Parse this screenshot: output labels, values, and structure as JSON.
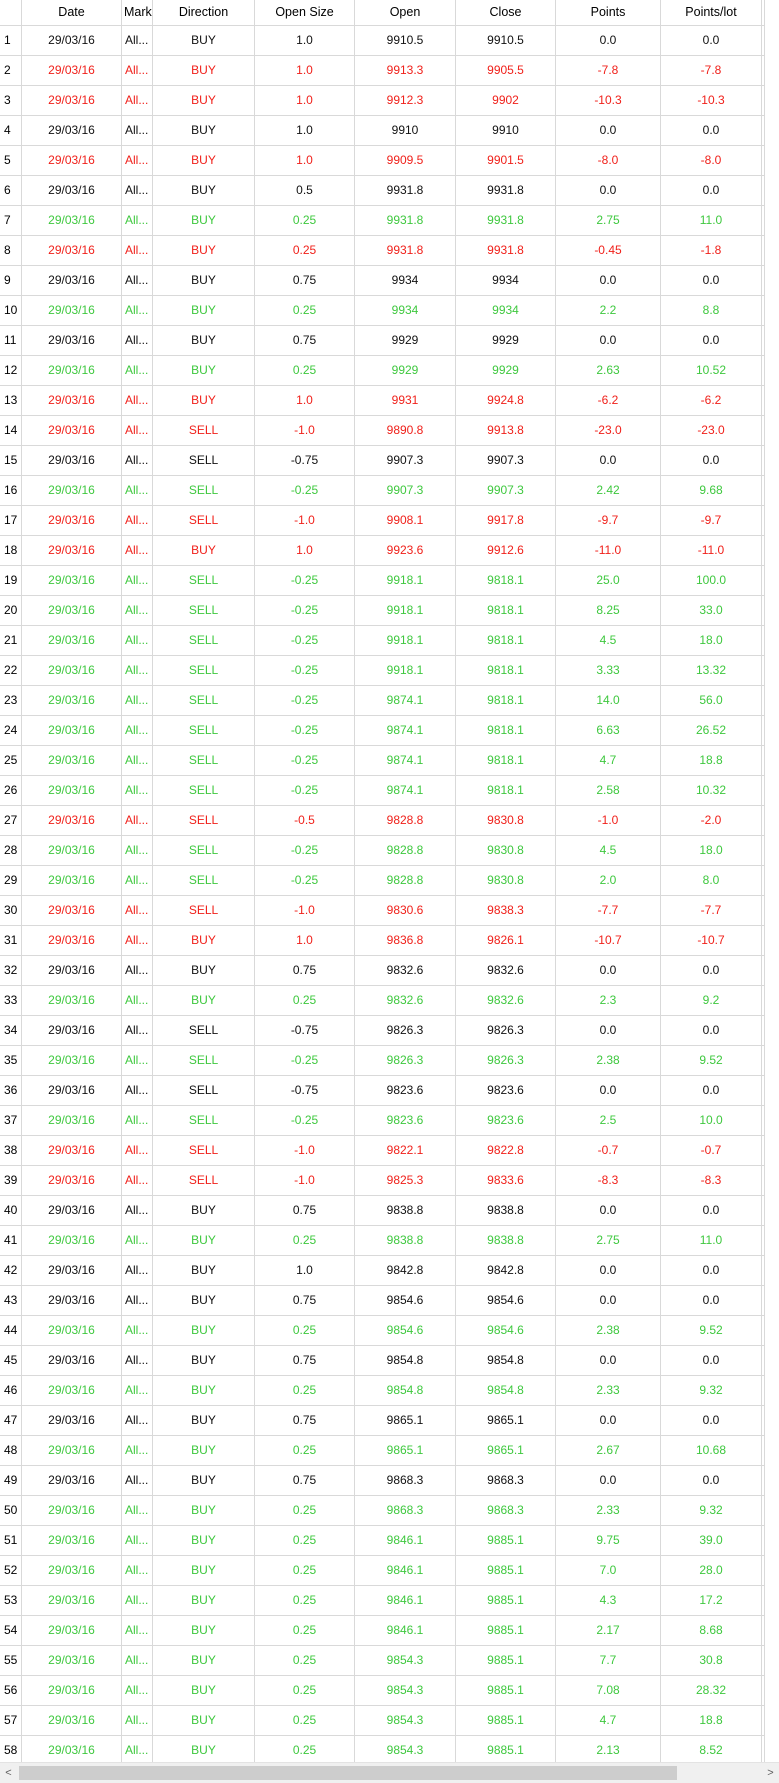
{
  "columns": [
    "Date",
    "Market",
    "Direction",
    "Open Size",
    "Open",
    "Close",
    "Points",
    "Points/lot"
  ],
  "colors": {
    "black": "#111111",
    "red": "#f0201a",
    "green": "#3ec83e",
    "grid": "#d9d9d9"
  },
  "scrollbar": {
    "left_arrow": "<",
    "right_arrow": ">"
  },
  "rows": [
    {
      "n": "1",
      "date": "29/03/16",
      "market": "All...",
      "dir": "BUY",
      "size": "1.0",
      "open": "9910.5",
      "close": "9910.5",
      "points": "0.0",
      "ppl": "0.0",
      "color": "black"
    },
    {
      "n": "2",
      "date": "29/03/16",
      "market": "All...",
      "dir": "BUY",
      "size": "1.0",
      "open": "9913.3",
      "close": "9905.5",
      "points": "-7.8",
      "ppl": "-7.8",
      "color": "red"
    },
    {
      "n": "3",
      "date": "29/03/16",
      "market": "All...",
      "dir": "BUY",
      "size": "1.0",
      "open": "9912.3",
      "close": "9902",
      "points": "-10.3",
      "ppl": "-10.3",
      "color": "red"
    },
    {
      "n": "4",
      "date": "29/03/16",
      "market": "All...",
      "dir": "BUY",
      "size": "1.0",
      "open": "9910",
      "close": "9910",
      "points": "0.0",
      "ppl": "0.0",
      "color": "black"
    },
    {
      "n": "5",
      "date": "29/03/16",
      "market": "All...",
      "dir": "BUY",
      "size": "1.0",
      "open": "9909.5",
      "close": "9901.5",
      "points": "-8.0",
      "ppl": "-8.0",
      "color": "red"
    },
    {
      "n": "6",
      "date": "29/03/16",
      "market": "All...",
      "dir": "BUY",
      "size": "0.5",
      "open": "9931.8",
      "close": "9931.8",
      "points": "0.0",
      "ppl": "0.0",
      "color": "black"
    },
    {
      "n": "7",
      "date": "29/03/16",
      "market": "All...",
      "dir": "BUY",
      "size": "0.25",
      "open": "9931.8",
      "close": "9931.8",
      "points": "2.75",
      "ppl": "11.0",
      "color": "green"
    },
    {
      "n": "8",
      "date": "29/03/16",
      "market": "All...",
      "dir": "BUY",
      "size": "0.25",
      "open": "9931.8",
      "close": "9931.8",
      "points": "-0.45",
      "ppl": "-1.8",
      "color": "red"
    },
    {
      "n": "9",
      "date": "29/03/16",
      "market": "All...",
      "dir": "BUY",
      "size": "0.75",
      "open": "9934",
      "close": "9934",
      "points": "0.0",
      "ppl": "0.0",
      "color": "black"
    },
    {
      "n": "10",
      "date": "29/03/16",
      "market": "All...",
      "dir": "BUY",
      "size": "0.25",
      "open": "9934",
      "close": "9934",
      "points": "2.2",
      "ppl": "8.8",
      "color": "green"
    },
    {
      "n": "11",
      "date": "29/03/16",
      "market": "All...",
      "dir": "BUY",
      "size": "0.75",
      "open": "9929",
      "close": "9929",
      "points": "0.0",
      "ppl": "0.0",
      "color": "black"
    },
    {
      "n": "12",
      "date": "29/03/16",
      "market": "All...",
      "dir": "BUY",
      "size": "0.25",
      "open": "9929",
      "close": "9929",
      "points": "2.63",
      "ppl": "10.52",
      "color": "green"
    },
    {
      "n": "13",
      "date": "29/03/16",
      "market": "All...",
      "dir": "BUY",
      "size": "1.0",
      "open": "9931",
      "close": "9924.8",
      "points": "-6.2",
      "ppl": "-6.2",
      "color": "red"
    },
    {
      "n": "14",
      "date": "29/03/16",
      "market": "All...",
      "dir": "SELL",
      "size": "-1.0",
      "open": "9890.8",
      "close": "9913.8",
      "points": "-23.0",
      "ppl": "-23.0",
      "color": "red"
    },
    {
      "n": "15",
      "date": "29/03/16",
      "market": "All...",
      "dir": "SELL",
      "size": "-0.75",
      "open": "9907.3",
      "close": "9907.3",
      "points": "0.0",
      "ppl": "0.0",
      "color": "black"
    },
    {
      "n": "16",
      "date": "29/03/16",
      "market": "All...",
      "dir": "SELL",
      "size": "-0.25",
      "open": "9907.3",
      "close": "9907.3",
      "points": "2.42",
      "ppl": "9.68",
      "color": "green"
    },
    {
      "n": "17",
      "date": "29/03/16",
      "market": "All...",
      "dir": "SELL",
      "size": "-1.0",
      "open": "9908.1",
      "close": "9917.8",
      "points": "-9.7",
      "ppl": "-9.7",
      "color": "red"
    },
    {
      "n": "18",
      "date": "29/03/16",
      "market": "All...",
      "dir": "BUY",
      "size": "1.0",
      "open": "9923.6",
      "close": "9912.6",
      "points": "-11.0",
      "ppl": "-11.0",
      "color": "red"
    },
    {
      "n": "19",
      "date": "29/03/16",
      "market": "All...",
      "dir": "SELL",
      "size": "-0.25",
      "open": "9918.1",
      "close": "9818.1",
      "points": "25.0",
      "ppl": "100.0",
      "color": "green"
    },
    {
      "n": "20",
      "date": "29/03/16",
      "market": "All...",
      "dir": "SELL",
      "size": "-0.25",
      "open": "9918.1",
      "close": "9818.1",
      "points": "8.25",
      "ppl": "33.0",
      "color": "green"
    },
    {
      "n": "21",
      "date": "29/03/16",
      "market": "All...",
      "dir": "SELL",
      "size": "-0.25",
      "open": "9918.1",
      "close": "9818.1",
      "points": "4.5",
      "ppl": "18.0",
      "color": "green"
    },
    {
      "n": "22",
      "date": "29/03/16",
      "market": "All...",
      "dir": "SELL",
      "size": "-0.25",
      "open": "9918.1",
      "close": "9818.1",
      "points": "3.33",
      "ppl": "13.32",
      "color": "green"
    },
    {
      "n": "23",
      "date": "29/03/16",
      "market": "All...",
      "dir": "SELL",
      "size": "-0.25",
      "open": "9874.1",
      "close": "9818.1",
      "points": "14.0",
      "ppl": "56.0",
      "color": "green"
    },
    {
      "n": "24",
      "date": "29/03/16",
      "market": "All...",
      "dir": "SELL",
      "size": "-0.25",
      "open": "9874.1",
      "close": "9818.1",
      "points": "6.63",
      "ppl": "26.52",
      "color": "green"
    },
    {
      "n": "25",
      "date": "29/03/16",
      "market": "All...",
      "dir": "SELL",
      "size": "-0.25",
      "open": "9874.1",
      "close": "9818.1",
      "points": "4.7",
      "ppl": "18.8",
      "color": "green"
    },
    {
      "n": "26",
      "date": "29/03/16",
      "market": "All...",
      "dir": "SELL",
      "size": "-0.25",
      "open": "9874.1",
      "close": "9818.1",
      "points": "2.58",
      "ppl": "10.32",
      "color": "green"
    },
    {
      "n": "27",
      "date": "29/03/16",
      "market": "All...",
      "dir": "SELL",
      "size": "-0.5",
      "open": "9828.8",
      "close": "9830.8",
      "points": "-1.0",
      "ppl": "-2.0",
      "color": "red"
    },
    {
      "n": "28",
      "date": "29/03/16",
      "market": "All...",
      "dir": "SELL",
      "size": "-0.25",
      "open": "9828.8",
      "close": "9830.8",
      "points": "4.5",
      "ppl": "18.0",
      "color": "green"
    },
    {
      "n": "29",
      "date": "29/03/16",
      "market": "All...",
      "dir": "SELL",
      "size": "-0.25",
      "open": "9828.8",
      "close": "9830.8",
      "points": "2.0",
      "ppl": "8.0",
      "color": "green"
    },
    {
      "n": "30",
      "date": "29/03/16",
      "market": "All...",
      "dir": "SELL",
      "size": "-1.0",
      "open": "9830.6",
      "close": "9838.3",
      "points": "-7.7",
      "ppl": "-7.7",
      "color": "red"
    },
    {
      "n": "31",
      "date": "29/03/16",
      "market": "All...",
      "dir": "BUY",
      "size": "1.0",
      "open": "9836.8",
      "close": "9826.1",
      "points": "-10.7",
      "ppl": "-10.7",
      "color": "red"
    },
    {
      "n": "32",
      "date": "29/03/16",
      "market": "All...",
      "dir": "BUY",
      "size": "0.75",
      "open": "9832.6",
      "close": "9832.6",
      "points": "0.0",
      "ppl": "0.0",
      "color": "black"
    },
    {
      "n": "33",
      "date": "29/03/16",
      "market": "All...",
      "dir": "BUY",
      "size": "0.25",
      "open": "9832.6",
      "close": "9832.6",
      "points": "2.3",
      "ppl": "9.2",
      "color": "green"
    },
    {
      "n": "34",
      "date": "29/03/16",
      "market": "All...",
      "dir": "SELL",
      "size": "-0.75",
      "open": "9826.3",
      "close": "9826.3",
      "points": "0.0",
      "ppl": "0.0",
      "color": "black"
    },
    {
      "n": "35",
      "date": "29/03/16",
      "market": "All...",
      "dir": "SELL",
      "size": "-0.25",
      "open": "9826.3",
      "close": "9826.3",
      "points": "2.38",
      "ppl": "9.52",
      "color": "green"
    },
    {
      "n": "36",
      "date": "29/03/16",
      "market": "All...",
      "dir": "SELL",
      "size": "-0.75",
      "open": "9823.6",
      "close": "9823.6",
      "points": "0.0",
      "ppl": "0.0",
      "color": "black"
    },
    {
      "n": "37",
      "date": "29/03/16",
      "market": "All...",
      "dir": "SELL",
      "size": "-0.25",
      "open": "9823.6",
      "close": "9823.6",
      "points": "2.5",
      "ppl": "10.0",
      "color": "green"
    },
    {
      "n": "38",
      "date": "29/03/16",
      "market": "All...",
      "dir": "SELL",
      "size": "-1.0",
      "open": "9822.1",
      "close": "9822.8",
      "points": "-0.7",
      "ppl": "-0.7",
      "color": "red"
    },
    {
      "n": "39",
      "date": "29/03/16",
      "market": "All...",
      "dir": "SELL",
      "size": "-1.0",
      "open": "9825.3",
      "close": "9833.6",
      "points": "-8.3",
      "ppl": "-8.3",
      "color": "red"
    },
    {
      "n": "40",
      "date": "29/03/16",
      "market": "All...",
      "dir": "BUY",
      "size": "0.75",
      "open": "9838.8",
      "close": "9838.8",
      "points": "0.0",
      "ppl": "0.0",
      "color": "black"
    },
    {
      "n": "41",
      "date": "29/03/16",
      "market": "All...",
      "dir": "BUY",
      "size": "0.25",
      "open": "9838.8",
      "close": "9838.8",
      "points": "2.75",
      "ppl": "11.0",
      "color": "green"
    },
    {
      "n": "42",
      "date": "29/03/16",
      "market": "All...",
      "dir": "BUY",
      "size": "1.0",
      "open": "9842.8",
      "close": "9842.8",
      "points": "0.0",
      "ppl": "0.0",
      "color": "black"
    },
    {
      "n": "43",
      "date": "29/03/16",
      "market": "All...",
      "dir": "BUY",
      "size": "0.75",
      "open": "9854.6",
      "close": "9854.6",
      "points": "0.0",
      "ppl": "0.0",
      "color": "black"
    },
    {
      "n": "44",
      "date": "29/03/16",
      "market": "All...",
      "dir": "BUY",
      "size": "0.25",
      "open": "9854.6",
      "close": "9854.6",
      "points": "2.38",
      "ppl": "9.52",
      "color": "green"
    },
    {
      "n": "45",
      "date": "29/03/16",
      "market": "All...",
      "dir": "BUY",
      "size": "0.75",
      "open": "9854.8",
      "close": "9854.8",
      "points": "0.0",
      "ppl": "0.0",
      "color": "black"
    },
    {
      "n": "46",
      "date": "29/03/16",
      "market": "All...",
      "dir": "BUY",
      "size": "0.25",
      "open": "9854.8",
      "close": "9854.8",
      "points": "2.33",
      "ppl": "9.32",
      "color": "green"
    },
    {
      "n": "47",
      "date": "29/03/16",
      "market": "All...",
      "dir": "BUY",
      "size": "0.75",
      "open": "9865.1",
      "close": "9865.1",
      "points": "0.0",
      "ppl": "0.0",
      "color": "black"
    },
    {
      "n": "48",
      "date": "29/03/16",
      "market": "All...",
      "dir": "BUY",
      "size": "0.25",
      "open": "9865.1",
      "close": "9865.1",
      "points": "2.67",
      "ppl": "10.68",
      "color": "green"
    },
    {
      "n": "49",
      "date": "29/03/16",
      "market": "All...",
      "dir": "BUY",
      "size": "0.75",
      "open": "9868.3",
      "close": "9868.3",
      "points": "0.0",
      "ppl": "0.0",
      "color": "black"
    },
    {
      "n": "50",
      "date": "29/03/16",
      "market": "All...",
      "dir": "BUY",
      "size": "0.25",
      "open": "9868.3",
      "close": "9868.3",
      "points": "2.33",
      "ppl": "9.32",
      "color": "green"
    },
    {
      "n": "51",
      "date": "29/03/16",
      "market": "All...",
      "dir": "BUY",
      "size": "0.25",
      "open": "9846.1",
      "close": "9885.1",
      "points": "9.75",
      "ppl": "39.0",
      "color": "green"
    },
    {
      "n": "52",
      "date": "29/03/16",
      "market": "All...",
      "dir": "BUY",
      "size": "0.25",
      "open": "9846.1",
      "close": "9885.1",
      "points": "7.0",
      "ppl": "28.0",
      "color": "green"
    },
    {
      "n": "53",
      "date": "29/03/16",
      "market": "All...",
      "dir": "BUY",
      "size": "0.25",
      "open": "9846.1",
      "close": "9885.1",
      "points": "4.3",
      "ppl": "17.2",
      "color": "green"
    },
    {
      "n": "54",
      "date": "29/03/16",
      "market": "All...",
      "dir": "BUY",
      "size": "0.25",
      "open": "9846.1",
      "close": "9885.1",
      "points": "2.17",
      "ppl": "8.68",
      "color": "green"
    },
    {
      "n": "55",
      "date": "29/03/16",
      "market": "All...",
      "dir": "BUY",
      "size": "0.25",
      "open": "9854.3",
      "close": "9885.1",
      "points": "7.7",
      "ppl": "30.8",
      "color": "green"
    },
    {
      "n": "56",
      "date": "29/03/16",
      "market": "All...",
      "dir": "BUY",
      "size": "0.25",
      "open": "9854.3",
      "close": "9885.1",
      "points": "7.08",
      "ppl": "28.32",
      "color": "green"
    },
    {
      "n": "57",
      "date": "29/03/16",
      "market": "All...",
      "dir": "BUY",
      "size": "0.25",
      "open": "9854.3",
      "close": "9885.1",
      "points": "4.7",
      "ppl": "18.8",
      "color": "green"
    },
    {
      "n": "58",
      "date": "29/03/16",
      "market": "All...",
      "dir": "BUY",
      "size": "0.25",
      "open": "9854.3",
      "close": "9885.1",
      "points": "2.13",
      "ppl": "8.52",
      "color": "green"
    }
  ]
}
